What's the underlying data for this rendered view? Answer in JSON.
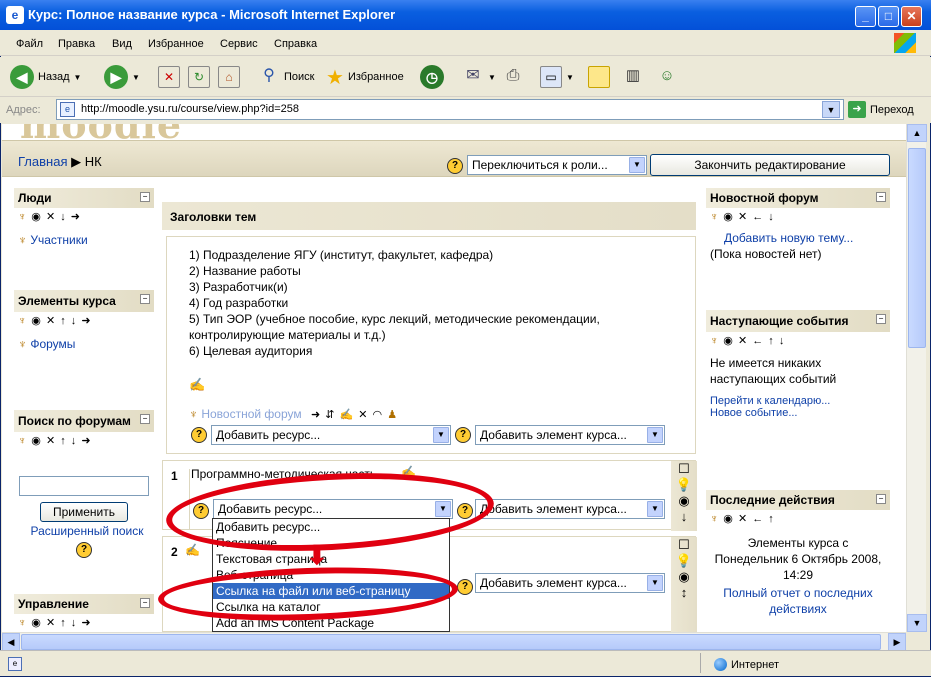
{
  "window": {
    "title": "Курс: Полное название курса - Microsoft Internet Explorer",
    "ie_icon": "e",
    "buttons": {
      "minimize": "_",
      "maximize": "□",
      "close": "✕"
    }
  },
  "menu": [
    "Файл",
    "Правка",
    "Вид",
    "Избранное",
    "Сервис",
    "Справка"
  ],
  "toolbar": {
    "back": "Назад",
    "search": "Поиск",
    "favorites": "Избранное"
  },
  "address": {
    "label": "Адрес:",
    "url": "http://moodle.ysu.ru/course/view.php?id=258",
    "go": "Переход"
  },
  "status": {
    "zone": "Интернет"
  },
  "moodle": {
    "logo": "moodle",
    "breadcrumb": {
      "home": "Главная",
      "sep": "▶",
      "course": "НК"
    },
    "role_select": "Переключиться к роли...",
    "end_editing": "Закончить редактирование",
    "help": "?",
    "left": {
      "people": {
        "title": "Люди",
        "participants": "Участники"
      },
      "elements": {
        "title": "Элементы курса",
        "forums": "Форумы"
      },
      "search": {
        "title": "Поиск по форумам",
        "apply": "Применить",
        "advanced": "Расширенный поиск"
      },
      "admin": {
        "title": "Управление"
      }
    },
    "center": {
      "topics_header": "Заголовки тем",
      "intro_lines": [
        "1) Подразделение ЯГУ (институт, факультет, кафедра)",
        "2) Название работы",
        "3) Разработчик(и)",
        "4) Год разработки",
        "5) Тип ЭОР (учебное пособие, курс лекций, методические рекомендации, контролирующие материалы и т.д.)",
        "6) Целевая аудитория"
      ],
      "news_forum": "Новостной форум",
      "add_resource": "Добавить ресурс...",
      "add_activity": "Добавить элемент курса...",
      "section1_num": "1",
      "section1_title": "Программно-методическая часть",
      "section2_num": "2",
      "dropdown_items": [
        "Добавить ресурс...",
        "Пояснение",
        "Текстовая страница",
        "Веб-страница",
        "Ссылка на файл или веб-страницу",
        "Ссылка на каталог",
        "Add an IMS Content Package"
      ]
    },
    "right": {
      "news": {
        "title": "Новостной форум",
        "add_topic": "Добавить новую тему...",
        "none": "(Пока новостей нет)"
      },
      "events": {
        "title": "Наступающие события",
        "none": "Не имеется никаких наступающих событий",
        "calendar": "Перейти к календарю...",
        "new_event": "Новое событие..."
      },
      "recent": {
        "title": "Последние действия",
        "text": "Элементы курса с Понедельник 6 Октябрь 2008, 14:29",
        "full_report": "Полный отчет о последних действиях"
      }
    }
  }
}
